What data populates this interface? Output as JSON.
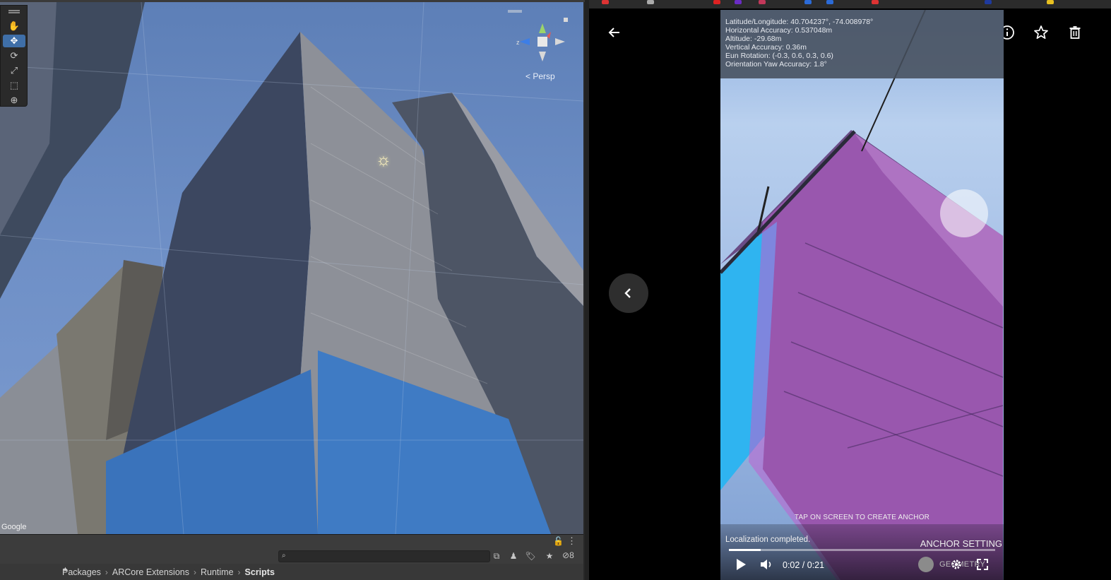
{
  "scene_view": {
    "projection_label": "Persp",
    "attribution": "Google",
    "tools": [
      "hand-tool",
      "move-tool",
      "rotate-tool",
      "scale-tool",
      "rect-tool",
      "transform-tool"
    ],
    "active_tool": "move-tool",
    "sky_color": "#6e8fc6"
  },
  "project": {
    "search_value": "",
    "hidden_count": "8",
    "breadcrumb": [
      "Packages",
      "ARCore Extensions",
      "Runtime",
      "Scripts"
    ]
  },
  "viewer": {
    "info_lines": [
      "Latitude/Longitude: 40.704237°, -74.008978°",
      "Horizontal Accuracy: 0.537048m",
      "Altitude: -29.68m",
      "Vertical Accuracy: 0.36m",
      "Eun Rotation: (-0.3, 0.6, 0.3, 0.6)",
      "Orientation Yaw Accuracy: 1.8°"
    ],
    "tap_hint": "TAP ON SCREEN TO CREATE ANCHOR",
    "toast": "Localization completed.",
    "anchor_setting": "ANCHOR SETTING",
    "geo_label": "GEOMETRY",
    "time": "0:02 / 0:21",
    "progress": 0.12,
    "overlay_color": "#c060d0",
    "accent_cyan": "#2fb4f0"
  }
}
